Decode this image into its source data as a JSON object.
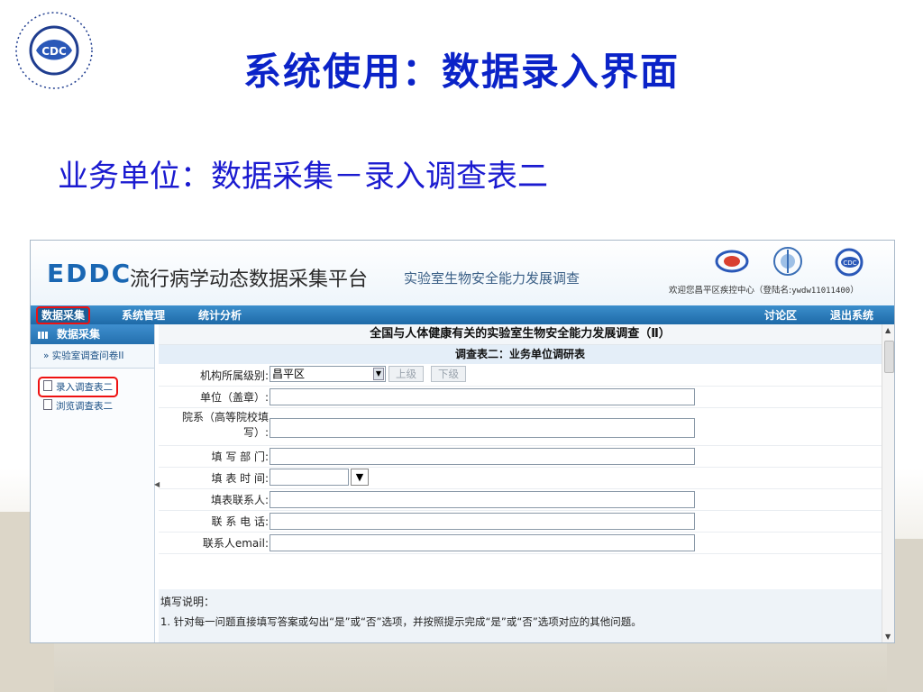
{
  "slide": {
    "title": "系统使用：数据录入界面",
    "subtitle": "业务单位：数据采集－录入调查表二"
  },
  "app": {
    "brand": "EDDC",
    "name": "流行病学动态数据采集平台",
    "subname": "实验室生物安全能力发展调查",
    "welcome_prefix": "欢迎您昌平区疾控中心（登陆名:",
    "account": "ywdw11011400",
    "welcome_suffix": "）",
    "nav": {
      "items": [
        "数据采集",
        "系统管理",
        "统计分析"
      ],
      "right_items": [
        "讨论区",
        "退出系统"
      ],
      "active": "数据采集"
    }
  },
  "sidebar": {
    "header": "数据采集",
    "section": "» 实验室调查问卷II",
    "items": [
      "录入调查表二",
      "浏览调查表二"
    ]
  },
  "form": {
    "title": "全国与人体健康有关的实验室生物安全能力发展调查（Ⅱ）",
    "subtitle": "调查表二：业务单位调研表",
    "fields": {
      "level_label": "机构所属级别:",
      "level_value": "昌平区",
      "up_button": "上级",
      "down_button": "下级",
      "unit_label": "单位（盖章）:",
      "dept_label": "院系（高等院校填写）:",
      "fill_dept_label": "填 写 部 门:",
      "fill_time_label": "填 表 时 间:",
      "contact_label": "填表联系人:",
      "phone_label": "联 系 电 话:",
      "email_label": "联系人email:"
    },
    "notes_heading": "填写说明：",
    "notes_item1": "1. 针对每一问题直接填写答案或勾出“是”或“否”选项，并按照提示完成“是”或“否”选项对应的其他问题。"
  }
}
